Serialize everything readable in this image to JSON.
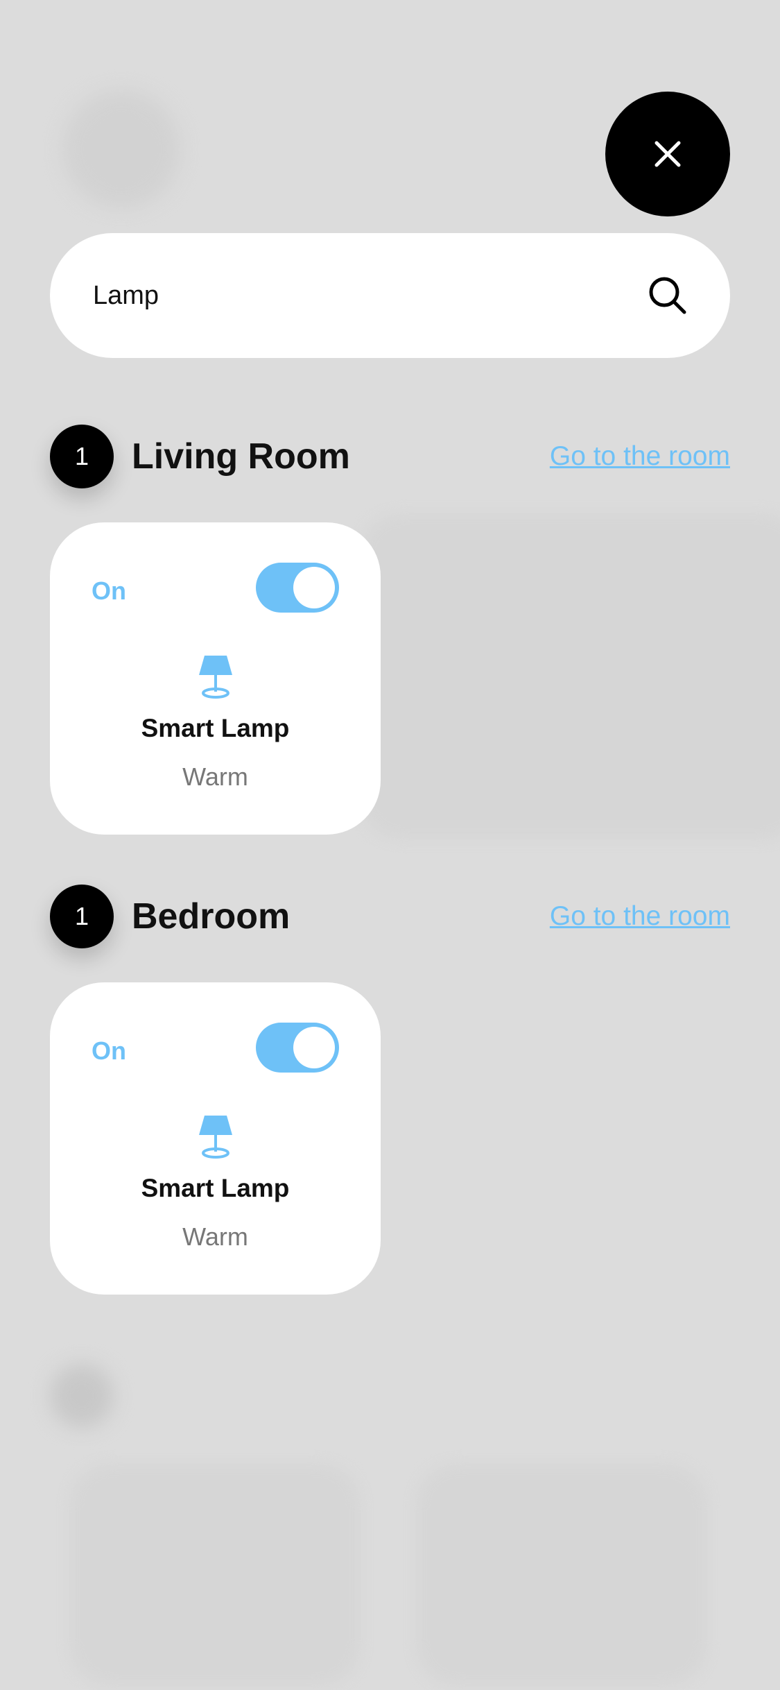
{
  "search": {
    "value": "Lamp"
  },
  "colors": {
    "accent": "#6ec1f7",
    "background": "#dcdcdc",
    "card": "#ffffff",
    "dark": "#000000"
  },
  "results": [
    {
      "count": "1",
      "room": "Living Room",
      "link": "Go to the room",
      "device": {
        "status": "On",
        "name": "Smart Lamp",
        "mode": "Warm",
        "icon": "lamp-icon",
        "toggle_on": true
      }
    },
    {
      "count": "1",
      "room": "Bedroom",
      "link": "Go to the room",
      "device": {
        "status": "On",
        "name": "Smart Lamp",
        "mode": "Warm",
        "icon": "lamp-icon",
        "toggle_on": true
      }
    }
  ]
}
